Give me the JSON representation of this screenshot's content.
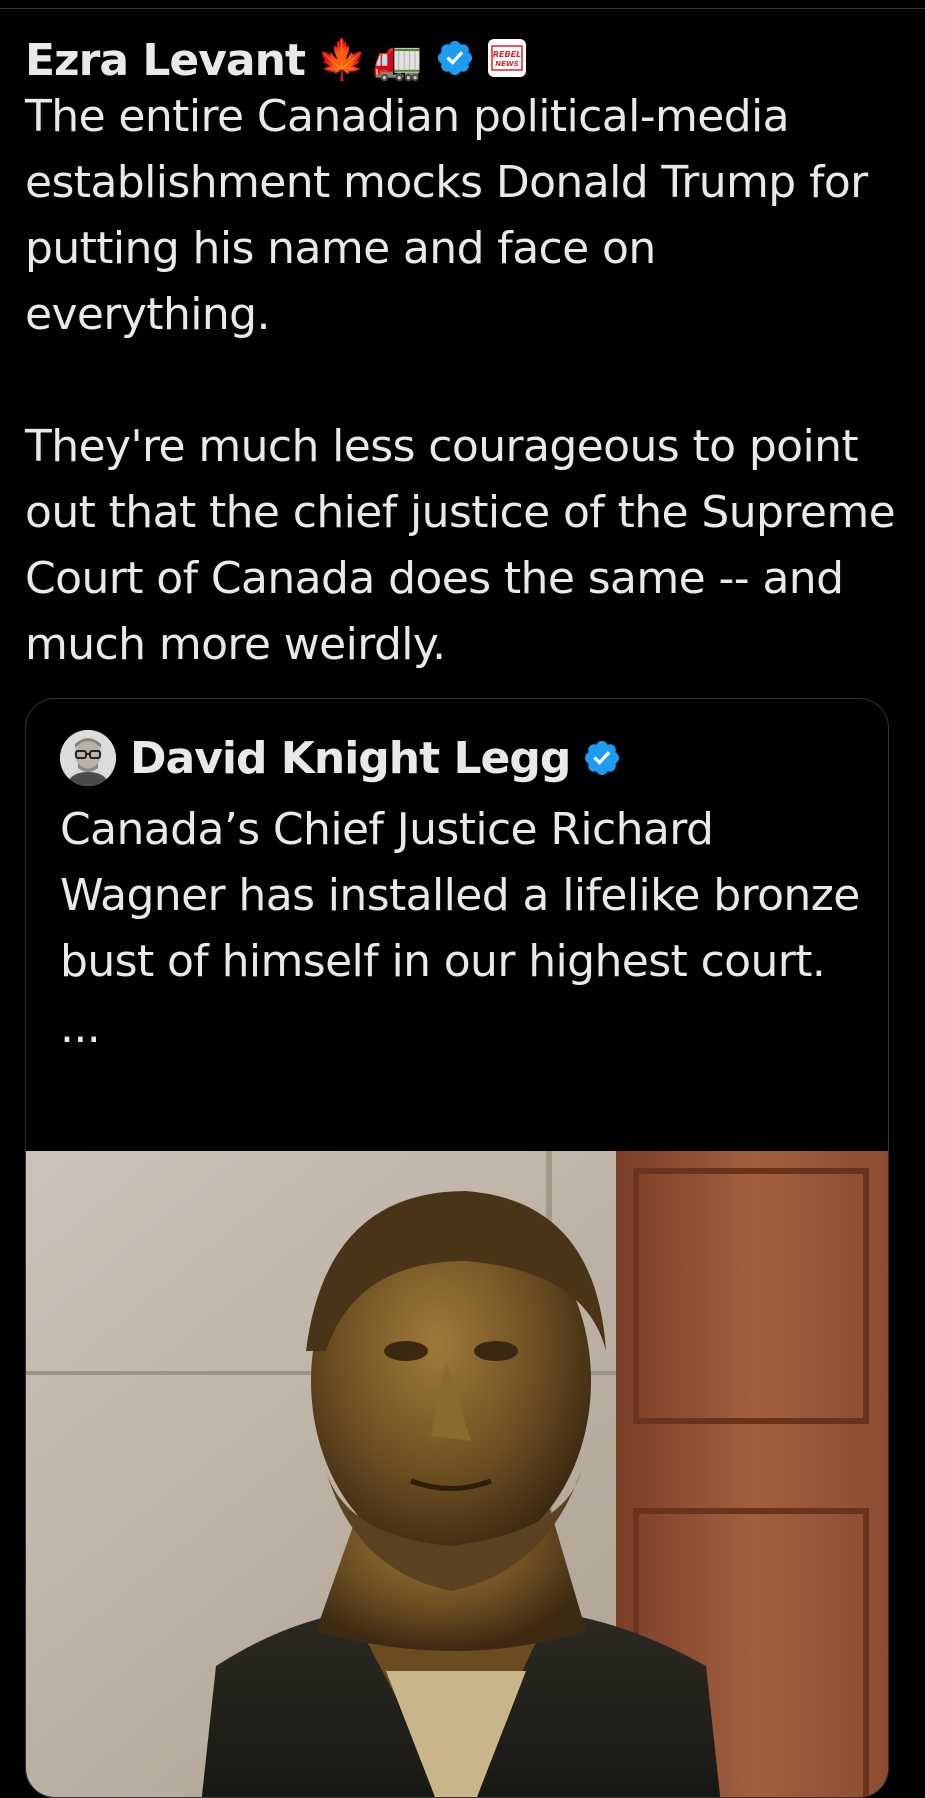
{
  "tweet": {
    "author_name": "Ezra Levant",
    "emoji_badges": [
      "🍁",
      "🚛"
    ],
    "rebel_badge_text": [
      "REBEL",
      "NEWS"
    ],
    "paragraph_1": "The entire Canadian political-media establishment mocks Donald Trump for putting his name and face on everything.",
    "paragraph_2": "They're much less courageous to point out that the chief justice of the Supreme Court of Canada does the same -- and much more weirdly."
  },
  "quoted_tweet": {
    "author_name": "David Knight Legg",
    "text": "Canada’s Chief Justice Richard Wagner has installed a lifelike bronze bust of himself in our highest court.",
    "truncation": "..."
  },
  "colors": {
    "background": "#000000",
    "text": "#e7e9ea",
    "verified_blue": "#1d9bf0",
    "border": "#2f3336"
  }
}
